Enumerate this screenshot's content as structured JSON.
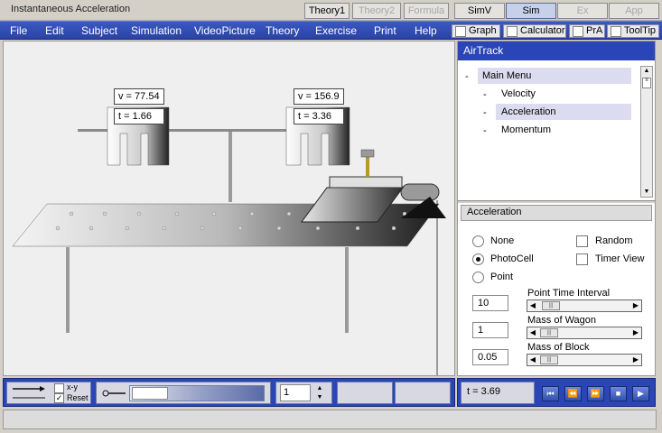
{
  "window": {
    "title": "Instantaneous Acceleration"
  },
  "title_tabs": [
    {
      "label": "Theory1",
      "state": "normal"
    },
    {
      "label": "Theory2",
      "state": "disabled"
    },
    {
      "label": "Formula",
      "state": "disabled"
    },
    {
      "label": "SimV",
      "state": "normal"
    },
    {
      "label": "Sim",
      "state": "active"
    },
    {
      "label": "Ex",
      "state": "disabled"
    },
    {
      "label": "App",
      "state": "disabled"
    }
  ],
  "menu": {
    "items": [
      "File",
      "Edit",
      "Subject",
      "Simulation",
      "VideoPicture",
      "Theory",
      "Exercise",
      "Print",
      "Help"
    ],
    "toggles": [
      "Graph",
      "Calculator",
      "PrA",
      "ToolTip"
    ]
  },
  "sim": {
    "gate1": {
      "velocity": "v = 77.54",
      "time": "t = 1.66"
    },
    "gate2": {
      "velocity": "v = 156.9",
      "time": "t = 3.36"
    }
  },
  "panel": {
    "title": "AirTrack",
    "tree": [
      {
        "label": "Main Menu",
        "selected": true
      },
      {
        "label": "Velocity",
        "selected": false
      },
      {
        "label": "Acceleration",
        "selected": true
      },
      {
        "label": "Momentum",
        "selected": false
      }
    ]
  },
  "acceleration": {
    "header": "Acceleration",
    "radios": [
      {
        "label": "None",
        "checked": false
      },
      {
        "label": "PhotoCell",
        "checked": true
      },
      {
        "label": "Point",
        "checked": false
      }
    ],
    "checkboxes": [
      {
        "label": "Random",
        "checked": false
      },
      {
        "label": "Timer View",
        "checked": false
      }
    ],
    "params": [
      {
        "value": "10",
        "label": "Point Time Interval"
      },
      {
        "value": "1",
        "label": "Mass of Wagon"
      },
      {
        "value": "0.05",
        "label": "Mass of Block"
      }
    ]
  },
  "bottom": {
    "xy_label": "x-y",
    "reset_label": "Reset",
    "stepper_value": "1",
    "time_readout": "t = 3.69"
  },
  "colors": {
    "menubar": "#2a45b5",
    "accent": "#3b58c2"
  }
}
